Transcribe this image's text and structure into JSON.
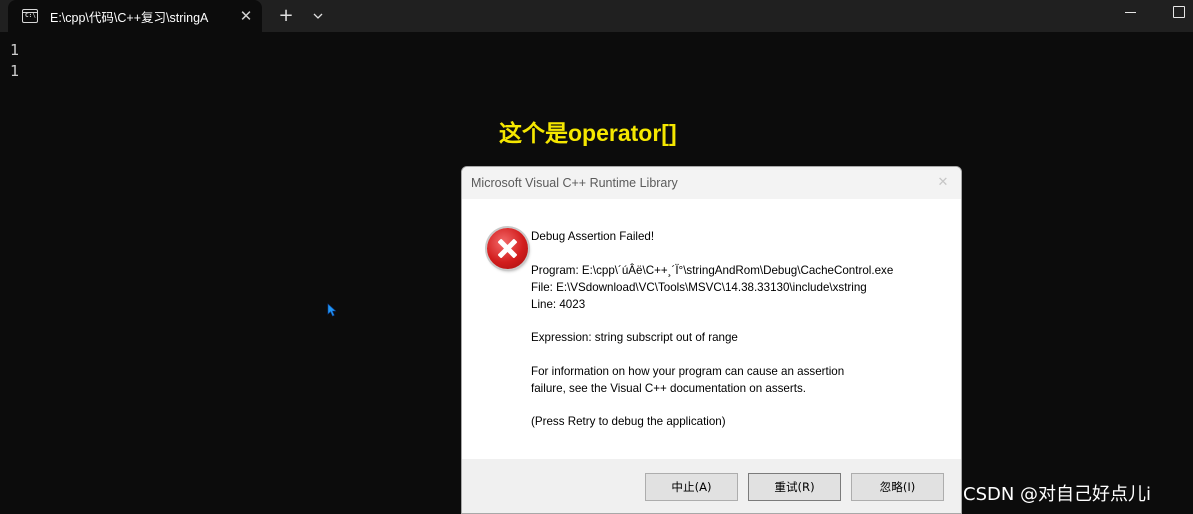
{
  "window": {
    "tab_title": "E:\\cpp\\代码\\C++复习\\stringA",
    "tab_close": "✕",
    "new_tab": "+"
  },
  "console": {
    "lines": [
      "1",
      "1"
    ]
  },
  "annotation": "这个是operator[]",
  "dialog": {
    "title": "Microsoft Visual C++ Runtime Library",
    "close": "✕",
    "heading": "Debug Assertion Failed!",
    "program": "Program: E:\\cpp\\´úÂë\\C++¸´Ï°\\stringAndRom\\Debug\\CacheControl.exe",
    "file": "File: E:\\VSdownload\\VC\\Tools\\MSVC\\14.38.33130\\include\\xstring",
    "line": "Line: 4023",
    "expression": "Expression: string subscript out of range",
    "info_1": "For information on how your program can cause an assertion",
    "info_2": "failure, see the Visual C++ documentation on asserts.",
    "press_retry": "(Press Retry to debug the application)",
    "buttons": {
      "abort": "中止(A)",
      "retry": "重试(R)",
      "ignore": "忽略(I)"
    }
  },
  "watermark": "CSDN @对自己好点儿i",
  "colors": {
    "console_bg": "#0c0c0c",
    "annotation": "#f5e700",
    "cursor": "#2196f3",
    "error_red": "#d21d1d"
  },
  "icons": {
    "tab": "terminal-icon",
    "dialog": "error-icon",
    "pointer": "mouse-cursor-icon"
  }
}
